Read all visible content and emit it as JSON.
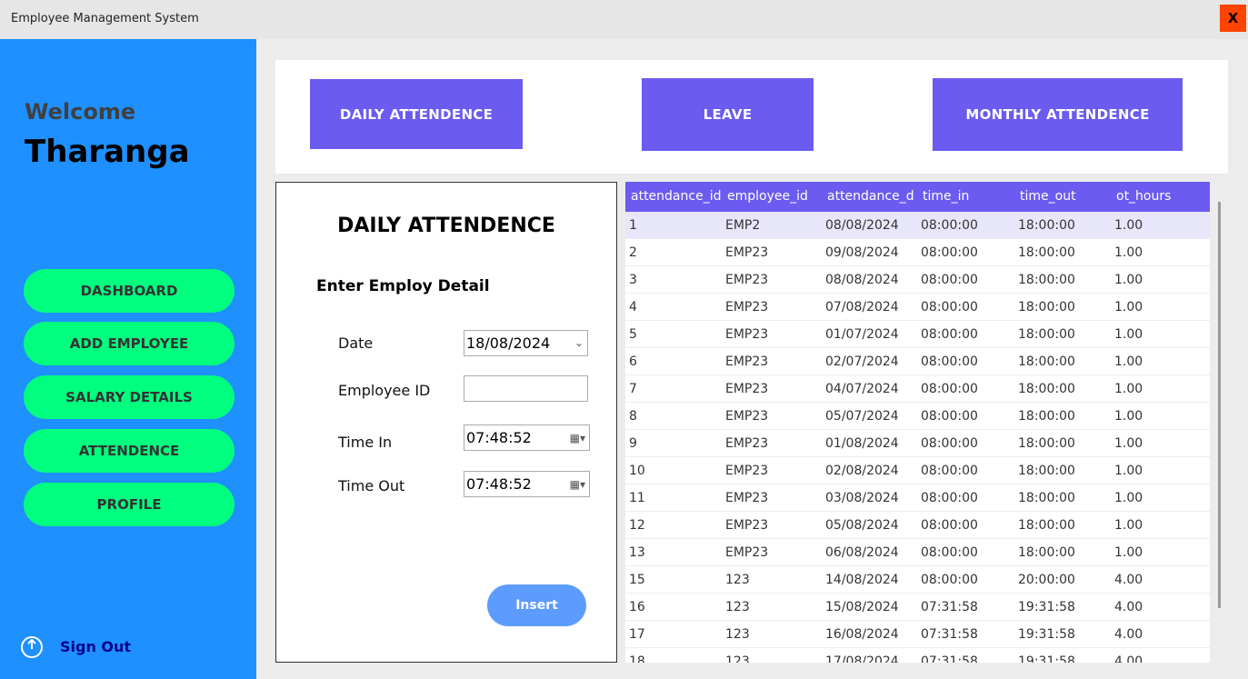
{
  "window": {
    "title": "Employee Management System",
    "close_label": "X"
  },
  "sidebar": {
    "welcome": "Welcome",
    "username": "Tharanga",
    "items": [
      {
        "label": "DASHBOARD"
      },
      {
        "label": "ADD EMPLOYEE"
      },
      {
        "label": "SALARY DETAILS"
      },
      {
        "label": "ATTENDENCE"
      },
      {
        "label": "PROFILE"
      }
    ],
    "signout": "Sign Out"
  },
  "tabs": [
    {
      "label": "DAILY ATTENDENCE"
    },
    {
      "label": "LEAVE"
    },
    {
      "label": "MONTHLY ATTENDENCE"
    }
  ],
  "form": {
    "title": "DAILY ATTENDENCE",
    "subtitle": "Enter Employ Detail",
    "date_label": "Date",
    "date_value": "18/08/2024",
    "employee_id_label": "Employee ID",
    "employee_id_value": "",
    "time_in_label": "Time In",
    "time_in_value": "07:48:52",
    "time_out_label": "Time Out",
    "time_out_value": "07:48:52",
    "insert_label": "Insert"
  },
  "table": {
    "columns": [
      "attendance_id",
      "employee_id",
      "attendance_d",
      "time_in",
      "time_out",
      "ot_hours"
    ],
    "rows": [
      [
        "1",
        "EMP2",
        "08/08/2024",
        "08:00:00",
        "18:00:00",
        "1.00"
      ],
      [
        "2",
        "EMP23",
        "09/08/2024",
        "08:00:00",
        "18:00:00",
        "1.00"
      ],
      [
        "3",
        "EMP23",
        "08/08/2024",
        "08:00:00",
        "18:00:00",
        "1.00"
      ],
      [
        "4",
        "EMP23",
        "07/08/2024",
        "08:00:00",
        "18:00:00",
        "1.00"
      ],
      [
        "5",
        "EMP23",
        "01/07/2024",
        "08:00:00",
        "18:00:00",
        "1.00"
      ],
      [
        "6",
        "EMP23",
        "02/07/2024",
        "08:00:00",
        "18:00:00",
        "1.00"
      ],
      [
        "7",
        "EMP23",
        "04/07/2024",
        "08:00:00",
        "18:00:00",
        "1.00"
      ],
      [
        "8",
        "EMP23",
        "05/07/2024",
        "08:00:00",
        "18:00:00",
        "1.00"
      ],
      [
        "9",
        "EMP23",
        "01/08/2024",
        "08:00:00",
        "18:00:00",
        "1.00"
      ],
      [
        "10",
        "EMP23",
        "02/08/2024",
        "08:00:00",
        "18:00:00",
        "1.00"
      ],
      [
        "11",
        "EMP23",
        "03/08/2024",
        "08:00:00",
        "18:00:00",
        "1.00"
      ],
      [
        "12",
        "EMP23",
        "05/08/2024",
        "08:00:00",
        "18:00:00",
        "1.00"
      ],
      [
        "13",
        "EMP23",
        "06/08/2024",
        "08:00:00",
        "18:00:00",
        "1.00"
      ],
      [
        "15",
        "123",
        "14/08/2024",
        "08:00:00",
        "20:00:00",
        "4.00"
      ],
      [
        "16",
        "123",
        "15/08/2024",
        "07:31:58",
        "19:31:58",
        "4.00"
      ],
      [
        "17",
        "123",
        "16/08/2024",
        "07:31:58",
        "19:31:58",
        "4.00"
      ],
      [
        "18",
        "123",
        "17/08/2024",
        "07:31:58",
        "19:31:58",
        "4.00"
      ]
    ]
  },
  "colors": {
    "sidebar": "#1e90ff",
    "nav_button": "#00ff7f",
    "accent": "#6b5bf0",
    "insert_button": "#5c9cff",
    "close": "#ff4400"
  }
}
